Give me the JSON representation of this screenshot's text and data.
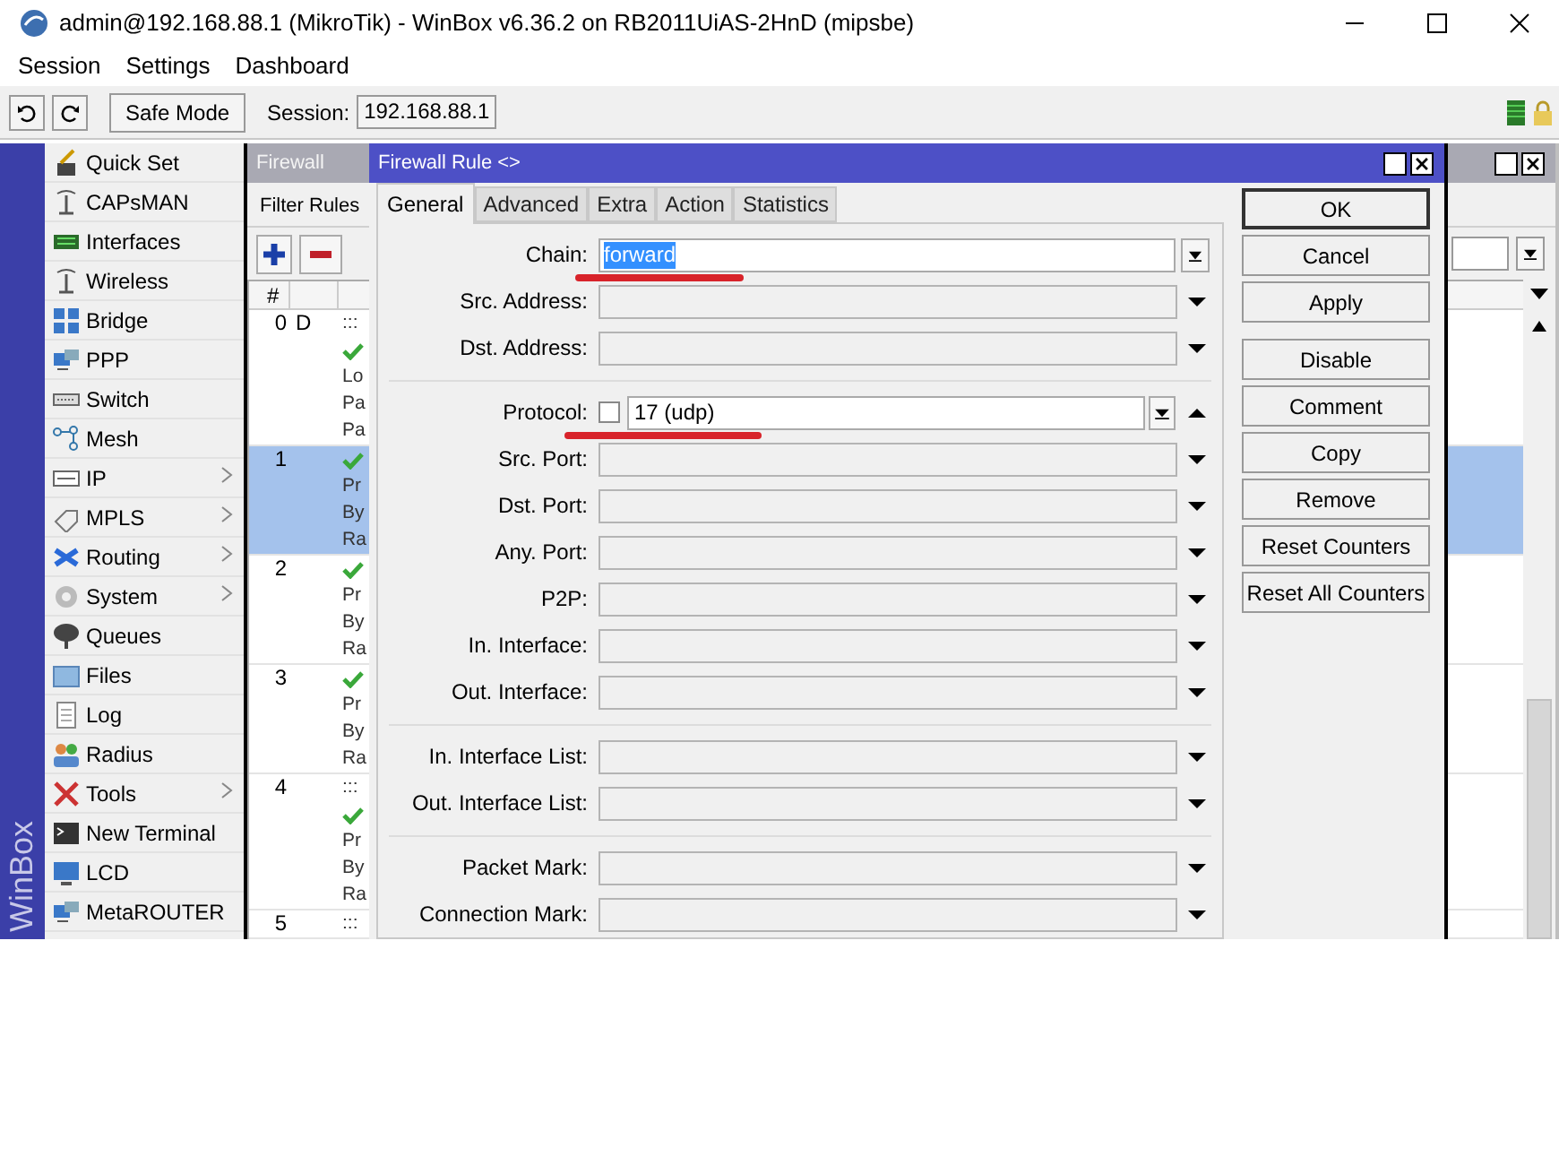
{
  "window": {
    "title": "admin@192.168.88.1 (MikroTik) - WinBox v6.36.2 on RB2011UiAS-2HnD (mipsbe)"
  },
  "menu": [
    "Session",
    "Settings",
    "Dashboard"
  ],
  "toolbar": {
    "safe_mode": "Safe Mode",
    "session_label": "Session:",
    "session_value": "192.168.88.1"
  },
  "sidebar": {
    "brand": "WinBox",
    "items": [
      {
        "label": "Quick Set",
        "submenu": false
      },
      {
        "label": "CAPsMAN",
        "submenu": false
      },
      {
        "label": "Interfaces",
        "submenu": false
      },
      {
        "label": "Wireless",
        "submenu": false
      },
      {
        "label": "Bridge",
        "submenu": false
      },
      {
        "label": "PPP",
        "submenu": false
      },
      {
        "label": "Switch",
        "submenu": false
      },
      {
        "label": "Mesh",
        "submenu": false
      },
      {
        "label": "IP",
        "submenu": true
      },
      {
        "label": "MPLS",
        "submenu": true
      },
      {
        "label": "Routing",
        "submenu": true
      },
      {
        "label": "System",
        "submenu": true
      },
      {
        "label": "Queues",
        "submenu": false
      },
      {
        "label": "Files",
        "submenu": false
      },
      {
        "label": "Log",
        "submenu": false
      },
      {
        "label": "Radius",
        "submenu": false
      },
      {
        "label": "Tools",
        "submenu": true
      },
      {
        "label": "New Terminal",
        "submenu": false
      },
      {
        "label": "LCD",
        "submenu": false
      },
      {
        "label": "MetaROUTER",
        "submenu": false
      }
    ]
  },
  "firewall_window": {
    "title": "Firewall",
    "tabs": [
      {
        "label": "Filter Rules",
        "selected": true
      }
    ],
    "table": {
      "columns": [
        "#"
      ],
      "rows": [
        {
          "number": "0",
          "flag": "D",
          "selected": false,
          "lines": [
            {
              "kind": "text",
              "text": ":::"
            },
            {
              "kind": "check"
            },
            {
              "kind": "text",
              "text": "Lo"
            },
            {
              "kind": "text",
              "text": "Pa"
            },
            {
              "kind": "text",
              "text": "Pa"
            }
          ]
        },
        {
          "number": "1",
          "selected": true,
          "lines": [
            {
              "kind": "check"
            },
            {
              "kind": "text",
              "text": "Pr"
            },
            {
              "kind": "text",
              "text": "By"
            },
            {
              "kind": "text",
              "text": "Ra"
            }
          ]
        },
        {
          "number": "2",
          "selected": false,
          "lines": [
            {
              "kind": "check"
            },
            {
              "kind": "text",
              "text": "Pr"
            },
            {
              "kind": "text",
              "text": "By"
            },
            {
              "kind": "text",
              "text": "Ra"
            }
          ]
        },
        {
          "number": "3",
          "selected": false,
          "lines": [
            {
              "kind": "check"
            },
            {
              "kind": "text",
              "text": "Pr"
            },
            {
              "kind": "text",
              "text": "By"
            },
            {
              "kind": "text",
              "text": "Ra"
            }
          ]
        },
        {
          "number": "4",
          "selected": false,
          "lines": [
            {
              "kind": "text",
              "text": ":::"
            },
            {
              "kind": "check"
            },
            {
              "kind": "text",
              "text": "Pr"
            },
            {
              "kind": "text",
              "text": "By"
            },
            {
              "kind": "text",
              "text": "Ra"
            }
          ]
        },
        {
          "number": "5",
          "selected": false,
          "lines": [
            {
              "kind": "text",
              "text": ":::"
            }
          ]
        }
      ]
    }
  },
  "rule_dialog": {
    "title": "Firewall Rule <>",
    "tabs": [
      {
        "label": "General",
        "selected": true
      },
      {
        "label": "Advanced",
        "selected": false
      },
      {
        "label": "Extra",
        "selected": false
      },
      {
        "label": "Action",
        "selected": false
      },
      {
        "label": "Statistics",
        "selected": false
      }
    ],
    "groups": [
      {
        "fields": [
          {
            "label": "Chain:",
            "kind": "combo",
            "value": "forward",
            "value_selected": true,
            "underlined": true
          },
          {
            "label": "Src. Address:",
            "kind": "empty"
          },
          {
            "label": "Dst. Address:",
            "kind": "empty"
          }
        ]
      },
      {
        "fields": [
          {
            "label": "Protocol:",
            "kind": "toggle",
            "checked": false,
            "value": "17 (udp)",
            "underlined": true
          },
          {
            "label": "Src. Port:",
            "kind": "empty"
          },
          {
            "label": "Dst. Port:",
            "kind": "empty"
          },
          {
            "label": "Any. Port:",
            "kind": "empty"
          },
          {
            "label": "P2P:",
            "kind": "empty"
          },
          {
            "label": "In. Interface:",
            "kind": "empty"
          },
          {
            "label": "Out. Interface:",
            "kind": "empty"
          }
        ]
      },
      {
        "fields": [
          {
            "label": "In. Interface List:",
            "kind": "empty"
          },
          {
            "label": "Out. Interface List:",
            "kind": "empty"
          }
        ]
      },
      {
        "fields": [
          {
            "label": "Packet Mark:",
            "kind": "empty"
          },
          {
            "label": "Connection Mark:",
            "kind": "empty"
          }
        ]
      }
    ],
    "button_groups": [
      [
        {
          "label": "OK",
          "default": true
        },
        {
          "label": "Cancel",
          "default": false
        },
        {
          "label": "Apply",
          "default": false
        }
      ],
      [
        {
          "label": "Disable",
          "default": false
        },
        {
          "label": "Comment",
          "default": false
        },
        {
          "label": "Copy",
          "default": false
        },
        {
          "label": "Remove",
          "default": false
        },
        {
          "label": "Reset Counters",
          "default": false
        },
        {
          "label": "Reset All Counters",
          "default": false
        }
      ]
    ]
  }
}
